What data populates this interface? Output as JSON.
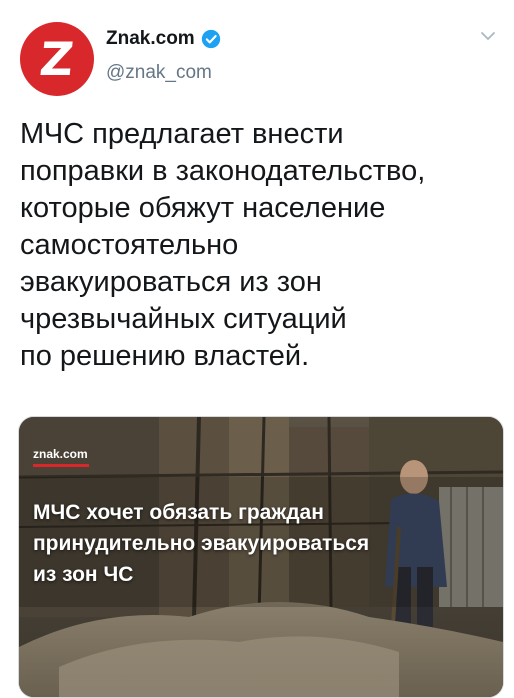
{
  "account": {
    "name": "Znak.com",
    "handle": "@znak_com",
    "avatar_letter": "Z",
    "avatar_color": "#d9282b",
    "verified_color": "#1da1f2"
  },
  "tweet": {
    "lines": [
      "МЧС предлагает внести",
      "поправки в законодательство,",
      "которые обяжут население",
      "самостоятельно",
      "эвакуироваться из зон",
      "чрезвычайных ситуаций",
      "по решению властей."
    ]
  },
  "card": {
    "site_logo": "znak.com",
    "headline_lines": [
      "МЧС хочет обязать граждан",
      "принудительно эвакуироваться",
      "из зон ЧС"
    ]
  },
  "icons": {
    "verified": "verified-badge-icon",
    "menu": "chevron-down-icon"
  }
}
